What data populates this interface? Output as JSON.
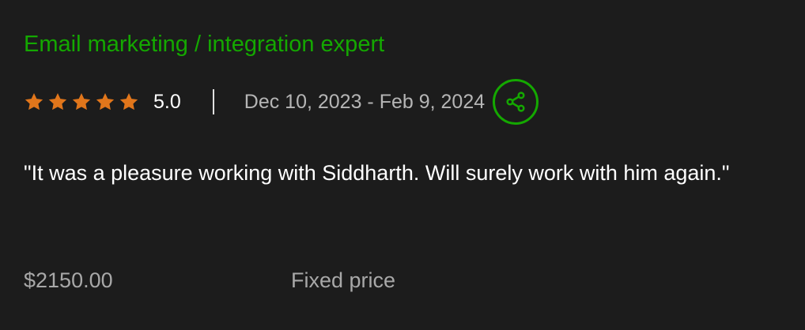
{
  "review": {
    "job_title": "Email marketing / integration expert",
    "rating": {
      "value": "5.0",
      "stars_filled": 5,
      "stars_total": 5,
      "star_color": "#e1761b"
    },
    "date_range": "Dec 10, 2023 - Feb 9, 2024",
    "share_icon": "share-icon",
    "feedback": "\"It was a pleasure working with Siddharth. Will surely work with him again.\"",
    "amount": "$2150.00",
    "price_type": "Fixed price"
  },
  "colors": {
    "background": "#1c1c1c",
    "accent_green": "#14a800",
    "muted_text": "#b5b5b5"
  }
}
